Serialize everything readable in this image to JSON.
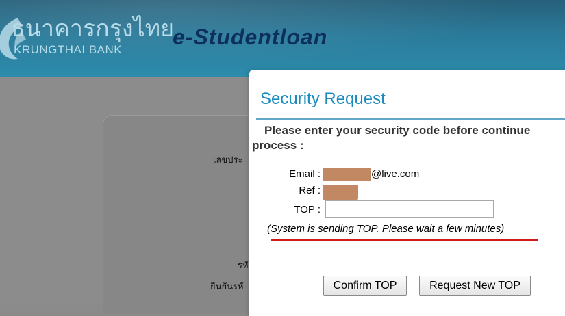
{
  "header": {
    "bank_name_thai": "ธนาคารกรุงไทย",
    "bank_name_en": "KRUNGTHAI BANK",
    "app_title": "e-Studentloan",
    "logo_icon": "krungthai-bird-logo"
  },
  "background_form": {
    "label_1": "เลขประ",
    "label_2": "รหั",
    "label_3": "ยืนยันรหั"
  },
  "modal": {
    "title": "Security Request",
    "instruction": "Please enter your security code before continue process :",
    "email_label": "Email :",
    "email_domain": "@live.com",
    "ref_label": "Ref :",
    "top_label": "TOP :",
    "top_value": "",
    "status_message": "(System is sending TOP. Please wait a few minutes)",
    "confirm_button": "Confirm TOP",
    "request_button": "Request New TOP"
  },
  "colors": {
    "banner": "#2a7a9a",
    "title_blue": "#1b8bbf",
    "underline_red": "#d01a1a",
    "redaction": "#c28763"
  }
}
